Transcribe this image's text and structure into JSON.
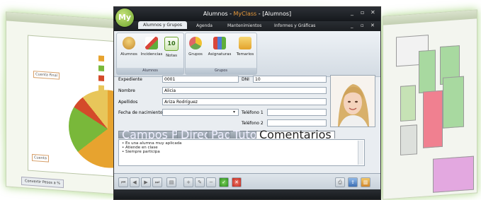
{
  "window": {
    "logo_text": "My",
    "title_prefix": "Alumnos - ",
    "title_highlight": "MyClass",
    "title_suffix": " - [Alumnos]",
    "controls": [
      "_",
      "▫",
      "✕"
    ]
  },
  "menu": {
    "tabs": [
      "Alumnos y Grupos",
      "Agenda",
      "Mantenimientos",
      "Informes y Gráficas"
    ]
  },
  "ribbon": {
    "groups": [
      {
        "label": "Alumnos",
        "buttons": [
          "Alumnos",
          "Incidencias",
          "Notas"
        ]
      },
      {
        "label": "Grupos",
        "buttons": [
          "Grupos",
          "Asignaturas",
          "Temarios"
        ]
      }
    ]
  },
  "form": {
    "expediente_label": "Expediente",
    "expediente_value": "0001",
    "dni_label": "DNI",
    "dni_value": "10",
    "nombre_label": "Nombre",
    "nombre_value": "Alicia",
    "apellidos_label": "Apellidos",
    "apellidos_value": "Ariza Rodríguez",
    "fecha_label": "Fecha de nacimiento",
    "fecha_value": "",
    "telefono1_label": "Teléfono 1",
    "telefono1_value": "",
    "telefono2_label": "Teléfono 2",
    "telefono2_value": ""
  },
  "tabs": [
    "Campos Personalizados",
    "Dirección",
    "Padres",
    "Tutorías",
    "Comentarios"
  ],
  "active_tab": "Comentarios",
  "comments": [
    "Es una alumna muy aplicada",
    "Atiende en clase",
    "Siempre participa"
  ],
  "left_window": {
    "label_top": "Cuenta Final",
    "label_bottom": "Cuenta",
    "button": "Convertir Pesos a %"
  },
  "colors": {
    "accent": "#e99a3a",
    "pie_orange": "#e7a32f",
    "pie_green": "#79b83a",
    "pie_red": "#d44a2a",
    "pie_yellow": "#e8c65a"
  },
  "icons": {
    "alumnos": "student-icon",
    "incidencias": "checklist-icon",
    "notas": "grade-icon",
    "grupos": "group-icon",
    "asignaturas": "books-icon",
    "temarios": "folder-icon"
  }
}
